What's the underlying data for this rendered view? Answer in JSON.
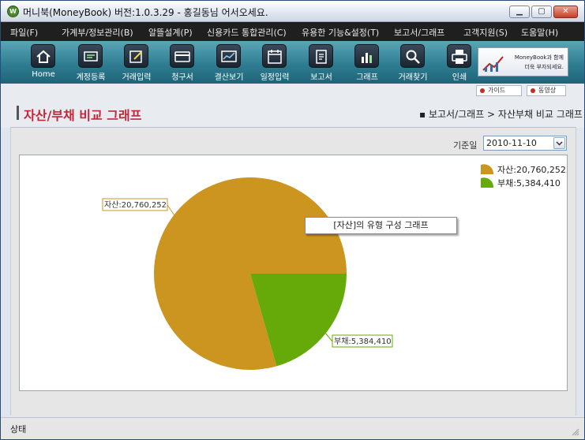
{
  "window": {
    "title": "머니북(MoneyBook) 버전:1.0.3.29 - 홍길동님 어서오세요.",
    "logo_letter": "W"
  },
  "menu": [
    {
      "label": "파일(F)"
    },
    {
      "label": "가계부/정보관리(B)"
    },
    {
      "label": "알뜰설계(P)"
    },
    {
      "label": "신용카드 통합관리(C)"
    },
    {
      "label": "유용한 기능&설정(T)"
    },
    {
      "label": "보고서/그래프"
    },
    {
      "label": "고객지원(S)"
    },
    {
      "label": "도움말(H)"
    }
  ],
  "toolbar": [
    {
      "label": "Home",
      "icon": "home-icon"
    },
    {
      "label": "계정등록",
      "icon": "account-register-icon"
    },
    {
      "label": "거래입력",
      "icon": "transaction-entry-icon"
    },
    {
      "label": "청구서",
      "icon": "card-bill-icon"
    },
    {
      "label": "결산보기",
      "icon": "settlement-view-icon"
    },
    {
      "label": "일정입력",
      "icon": "calendar-icon"
    },
    {
      "label": "보고서",
      "icon": "report-icon"
    },
    {
      "label": "그래프",
      "icon": "bar-chart-icon"
    },
    {
      "label": "거래찾기",
      "icon": "search-icon"
    },
    {
      "label": "인쇄",
      "icon": "printer-icon"
    }
  ],
  "banner": {
    "line1": "MoneyBook과 함께",
    "line2": "더욱 부자되세요."
  },
  "guide_buttons": {
    "guide": "가이드",
    "video": "동영상"
  },
  "page": {
    "title": "자산/부채 비교 그래프",
    "breadcrumb": "▪ 보고서/그래프 > 자산부채 비교 그래프"
  },
  "filter": {
    "date_label": "기준일",
    "date_value": "2010-11-10"
  },
  "chart_data": {
    "type": "pie",
    "categories": [
      "자산",
      "부채"
    ],
    "values": [
      20760252,
      5384410
    ],
    "labels": [
      "자산:20,760,252",
      "부채:5,384,410"
    ],
    "colors": [
      "#cc9520",
      "#66aa0a"
    ],
    "legend_position": "top-right",
    "tooltip": "[자산]의 유형 구성 그래프"
  },
  "status": {
    "text": "상태"
  }
}
